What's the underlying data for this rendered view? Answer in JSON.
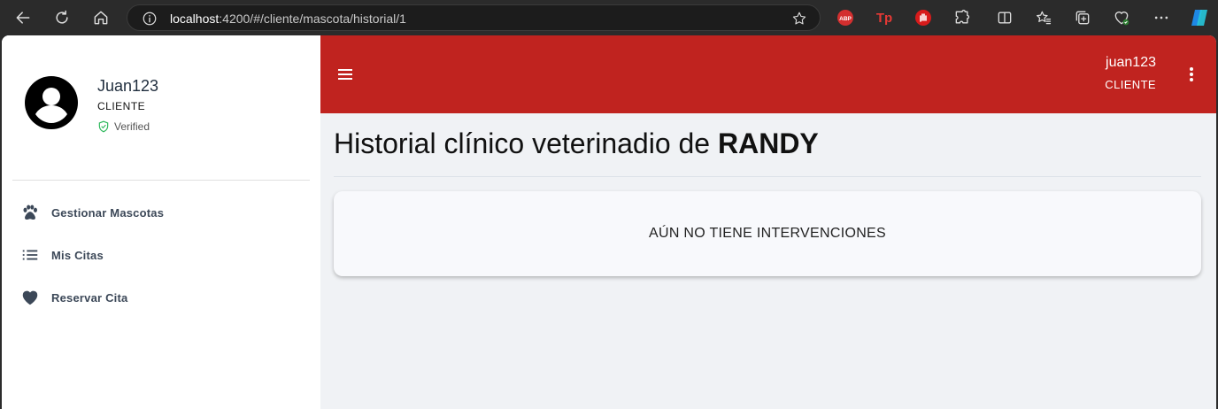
{
  "browser": {
    "url_host": "localhost",
    "url_rest": ":4200/#/cliente/mascota/historial/1",
    "extensions": [
      "abp-icon",
      "tp-icon",
      "hand-icon",
      "puzzle-icon",
      "split-icon",
      "favorites-icon",
      "collections-icon",
      "health-icon",
      "more-icon",
      "copilot-icon"
    ],
    "abp_label": "ABP",
    "tp_label": "Tp"
  },
  "sidebar": {
    "user_name": "Juan123",
    "user_role": "CLIENTE",
    "verified_label": "Verified",
    "items": [
      {
        "label": "Gestionar Mascotas",
        "icon": "paw-icon"
      },
      {
        "label": "Mis Citas",
        "icon": "list-icon"
      },
      {
        "label": "Reservar Cita",
        "icon": "heart-icon"
      }
    ]
  },
  "header": {
    "user_name": "juan123",
    "user_role": "CLIENTE",
    "accent_color": "#c0231f"
  },
  "main": {
    "title_prefix": "Historial clínico veterinadio de ",
    "pet_name": "RANDY",
    "empty_message": "AÚN NO TIENE INTERVENCIONES"
  }
}
